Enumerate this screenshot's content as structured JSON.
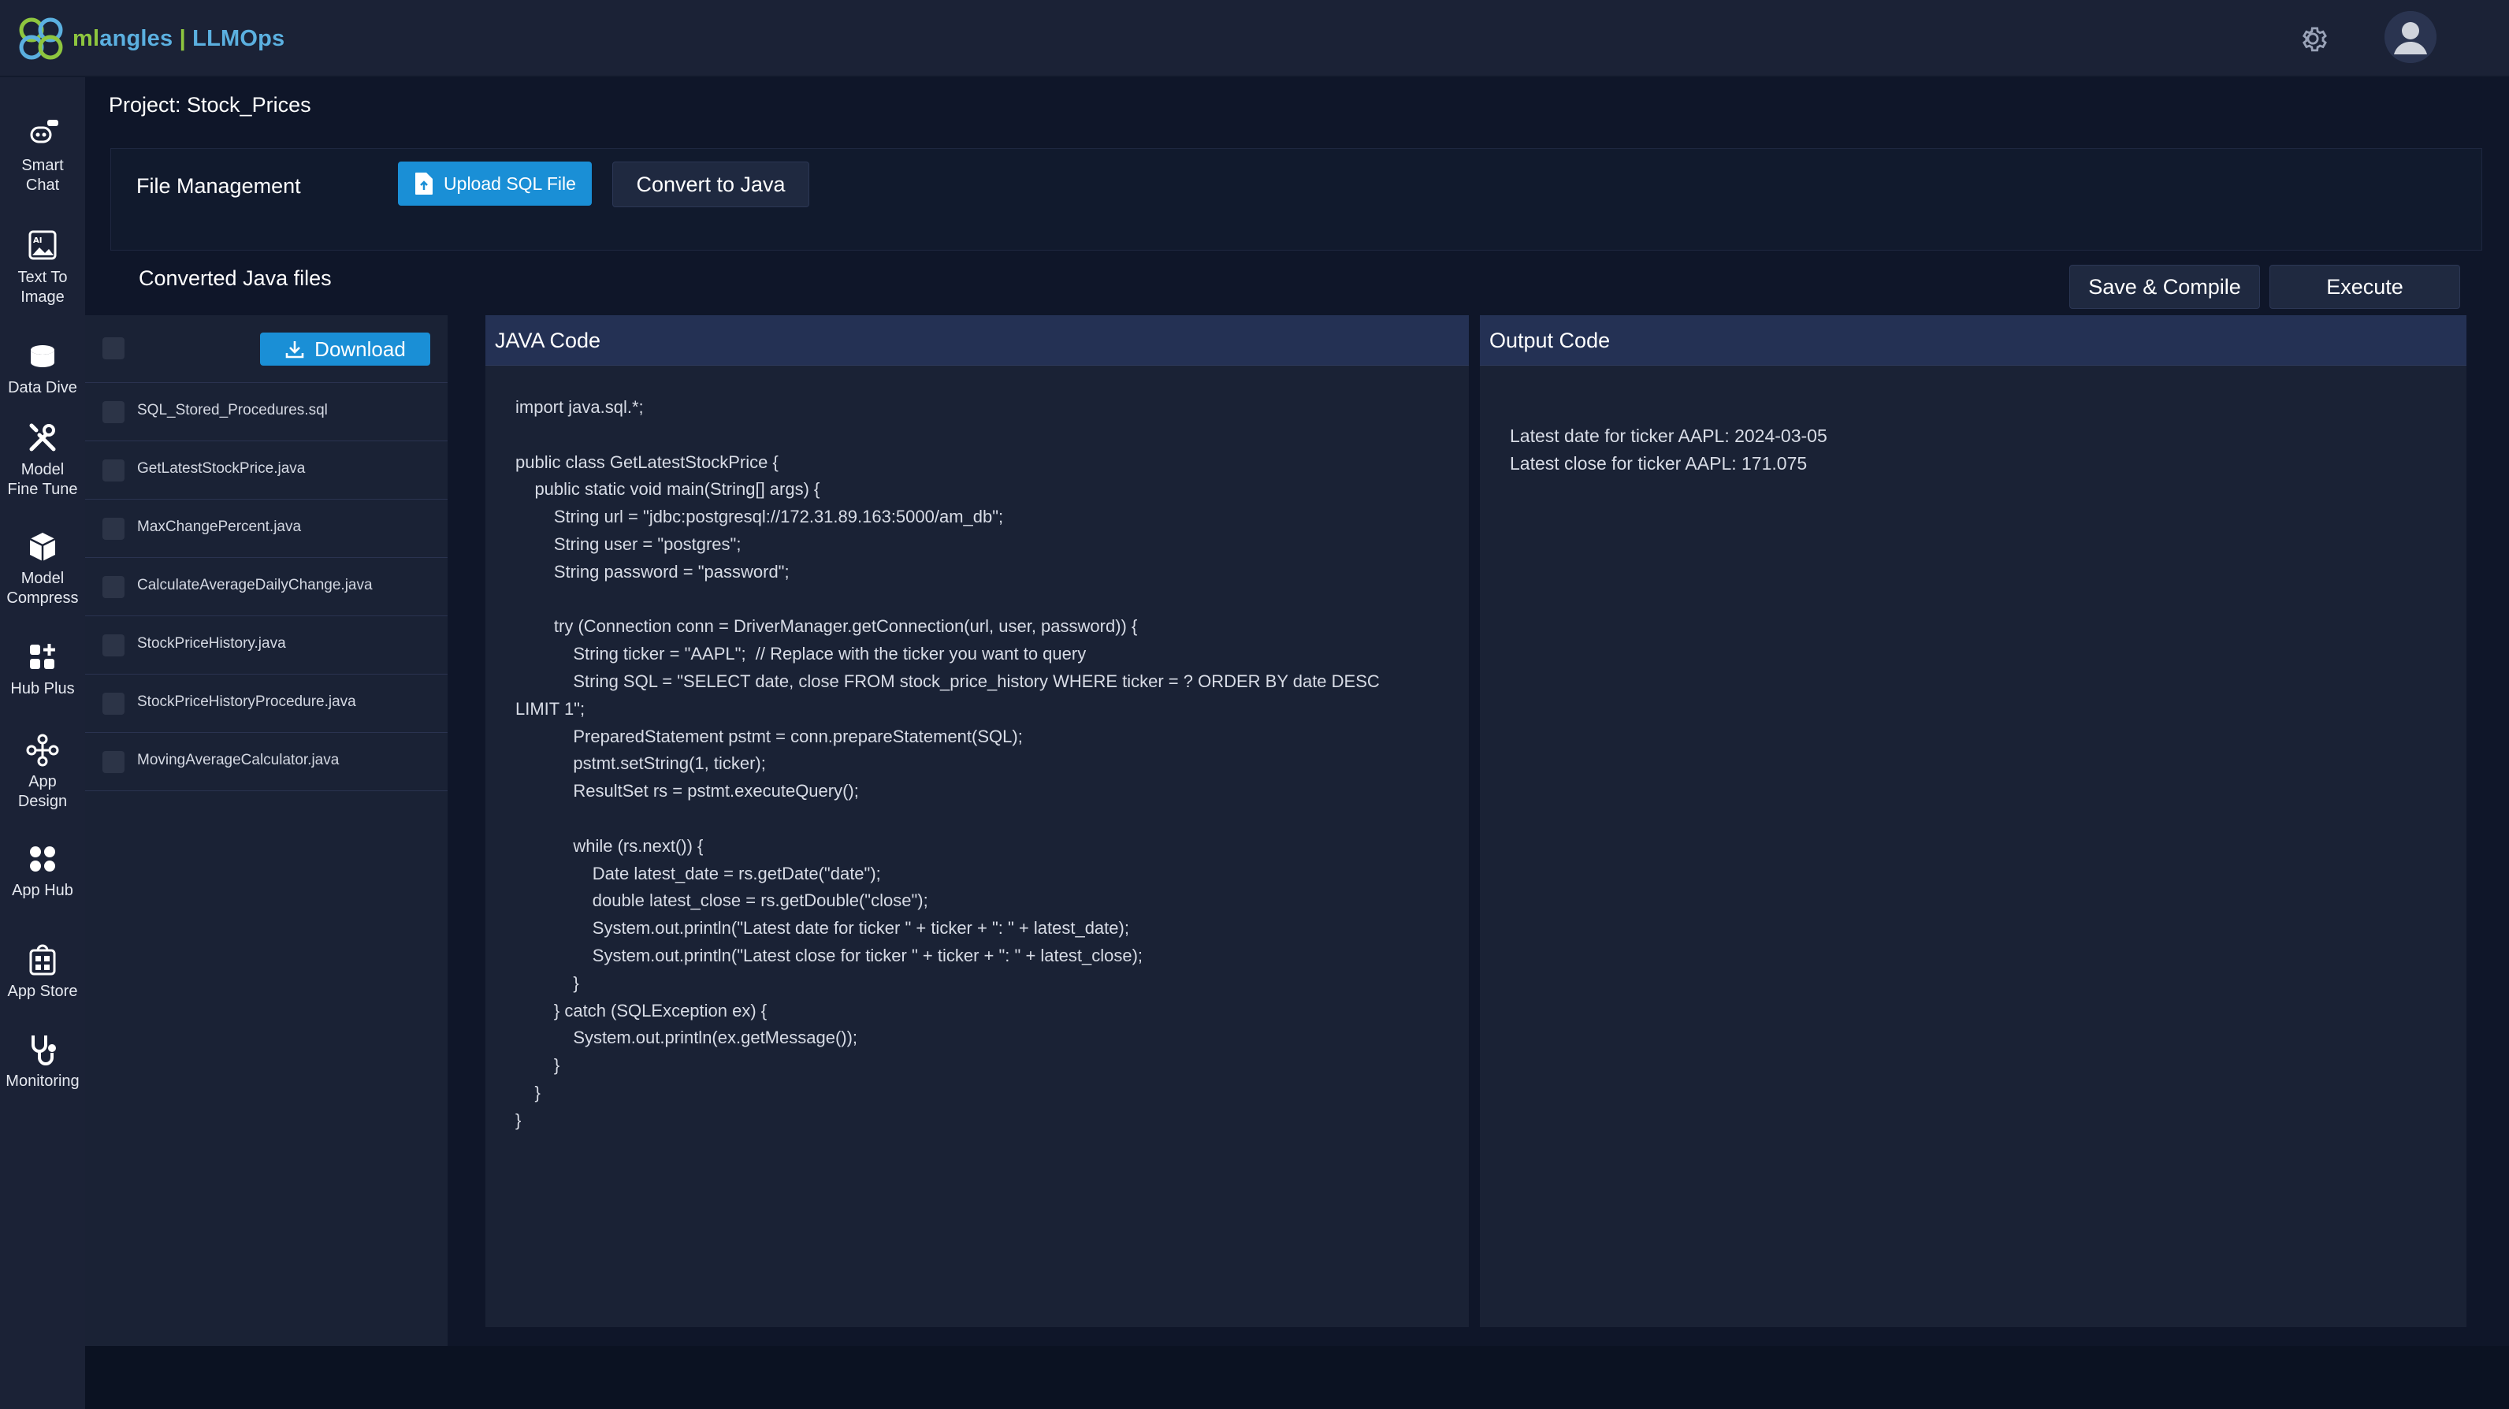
{
  "brand": {
    "part1": "ml",
    "part2": "angles",
    "part3": " | ",
    "part4": "LLMOps"
  },
  "colors": {
    "primary_button": "#1a8fd6",
    "panel_header": "#243154",
    "nav_bg": "#1b2236",
    "page_bg": "#0f1629"
  },
  "header": {
    "settings_icon": "gear-icon",
    "avatar_icon": "user-avatar-icon"
  },
  "nav": {
    "items": [
      {
        "label_line1": "Smart",
        "label_line2": "Chat",
        "icon": "robot-chat-icon"
      },
      {
        "label_line1": "Text To",
        "label_line2": "Image",
        "icon": "ai-image-icon"
      },
      {
        "label_line1": "Data Dive",
        "label_line2": "",
        "icon": "database-icon"
      },
      {
        "label_line1": "Model",
        "label_line2": "Fine Tune",
        "icon": "tools-icon"
      },
      {
        "label_line1": "Model",
        "label_line2": "Compress",
        "icon": "cube-icon"
      },
      {
        "label_line1": "Hub Plus",
        "label_line2": "",
        "icon": "grid-plus-icon"
      },
      {
        "label_line1": "App",
        "label_line2": "Design",
        "icon": "design-icon"
      },
      {
        "label_line1": "App Hub",
        "label_line2": "",
        "icon": "app-grid-icon"
      },
      {
        "label_line1": "App Store",
        "label_line2": "",
        "icon": "store-icon"
      },
      {
        "label_line1": "Monitoring",
        "label_line2": "",
        "icon": "stethoscope-icon"
      }
    ]
  },
  "project": {
    "title": "Project: Stock_Prices"
  },
  "file_management": {
    "label": "File Management",
    "upload_label": "Upload SQL File",
    "convert_label": "Convert to Java"
  },
  "converted": {
    "title": "Converted Java files",
    "save_label": "Save & Compile",
    "execute_label": "Execute",
    "download_label": "Download",
    "files": [
      "SQL_Stored_Procedures.sql",
      "GetLatestStockPrice.java",
      "MaxChangePercent.java",
      "CalculateAverageDailyChange.java",
      "StockPriceHistory.java",
      "StockPriceHistoryProcedure.java",
      "MovingAverageCalculator.java"
    ]
  },
  "java_panel": {
    "title": "JAVA Code",
    "code": "import java.sql.*;\n\npublic class GetLatestStockPrice {\n    public static void main(String[] args) {\n        String url = \"jdbc:postgresql://172.31.89.163:5000/am_db\";\n        String user = \"postgres\";\n        String password = \"password\";\n\n        try (Connection conn = DriverManager.getConnection(url, user, password)) {\n            String ticker = \"AAPL\";  // Replace with the ticker you want to query\n            String SQL = \"SELECT date, close FROM stock_price_history WHERE ticker = ? ORDER BY date DESC\nLIMIT 1\";\n            PreparedStatement pstmt = conn.prepareStatement(SQL);\n            pstmt.setString(1, ticker);\n            ResultSet rs = pstmt.executeQuery();\n\n            while (rs.next()) {\n                Date latest_date = rs.getDate(\"date\");\n                double latest_close = rs.getDouble(\"close\");\n                System.out.println(\"Latest date for ticker \" + ticker + \": \" + latest_date);\n                System.out.println(\"Latest close for ticker \" + ticker + \": \" + latest_close);\n            }\n        } catch (SQLException ex) {\n            System.out.println(ex.getMessage());\n        }\n    }\n}"
  },
  "output_panel": {
    "title": "Output Code",
    "output": "Latest date for ticker AAPL: 2024-03-05\nLatest close for ticker AAPL: 171.075"
  }
}
